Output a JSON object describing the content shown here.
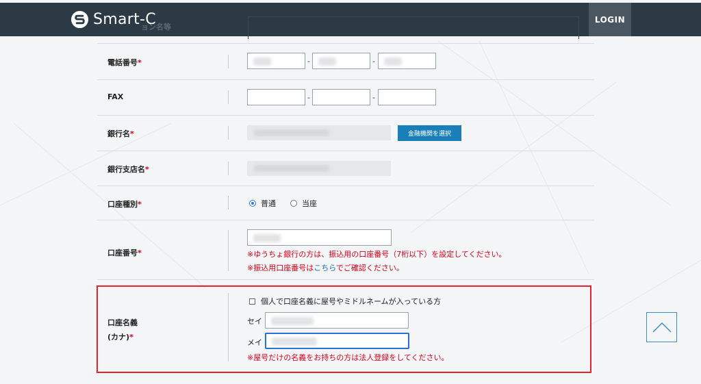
{
  "header": {
    "logo_text": "Smart-C",
    "hidden_label": "ョン名等",
    "login_label": "LOGIN"
  },
  "form": {
    "phone": {
      "label": "電話番号",
      "required_mark": "*",
      "separator": "-"
    },
    "fax": {
      "label": "FAX",
      "separator": "-"
    },
    "bank_name": {
      "label": "銀行名",
      "required_mark": "*",
      "select_button": "金融機関を選択"
    },
    "branch_name": {
      "label": "銀行支店名",
      "required_mark": "*"
    },
    "account_type": {
      "label": "口座種別",
      "required_mark": "*",
      "options": [
        {
          "label": "普通",
          "selected": true
        },
        {
          "label": "当座",
          "selected": false
        }
      ]
    },
    "account_number": {
      "label": "口座番号",
      "required_mark": "*",
      "note1": "※ゆうちょ銀行の方は、振込用の口座番号（7桁以下）を設定してください。",
      "note2_prefix": "※振込用口座番号は",
      "note2_link": "こちら",
      "note2_suffix": "でご確認ください。"
    },
    "account_holder": {
      "label_line1": "口座名義",
      "label_line2": "(カナ)",
      "required_mark": "*",
      "checkbox_label": "個人で口座名義に屋号やミドルネームが入っている方",
      "sei_label": "セイ",
      "mei_label": "メイ",
      "note": "※屋号だけの名義をお持ちの方は法人登録をしてください。"
    }
  },
  "colors": {
    "header_bg": "#2b3a44",
    "accent_blue": "#1a7fb8",
    "required_red": "#d9001b",
    "highlight_red": "#e4242b"
  },
  "icons": {
    "logo": "logo-s-icon",
    "scroll_top": "chevron-up-icon"
  }
}
